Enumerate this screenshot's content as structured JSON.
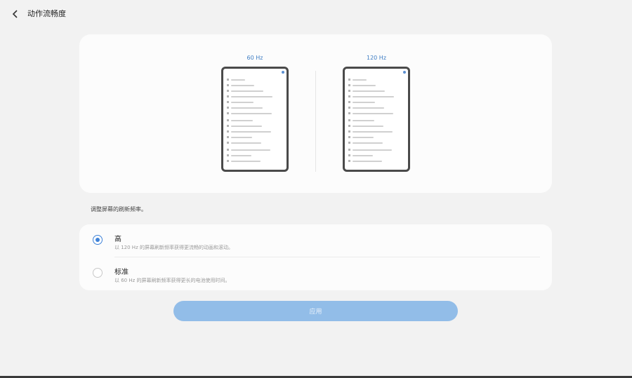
{
  "header": {
    "title": "动作流畅度",
    "back_icon": "chevron-left-icon"
  },
  "preview": {
    "left_label": "60 Hz",
    "right_label": "120 Hz"
  },
  "section_label": "调整屏幕的刷新频率。",
  "options": [
    {
      "title": "高",
      "description": "以 120 Hz 的屏幕刷新频率获得更流畅的动画和滚动。",
      "selected": true
    },
    {
      "title": "标准",
      "description": "以 60 Hz 的屏幕刷新频率获得更长的电池使用时间。",
      "selected": false
    }
  ],
  "apply_label": "应用",
  "colors": {
    "accent": "#3e82d8",
    "button": "#92bde8",
    "hz_label": "#3e7dc4"
  }
}
